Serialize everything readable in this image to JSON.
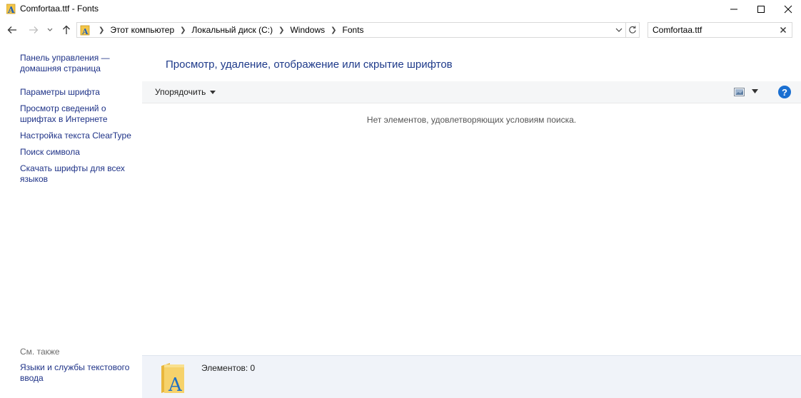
{
  "window": {
    "title": "Comfortaa.ttf - Fonts",
    "controls": [
      "minimize",
      "maximize",
      "close"
    ]
  },
  "nav": {
    "breadcrumbs": [
      "Этот компьютер",
      "Локальный диск (C:)",
      "Windows",
      "Fonts"
    ],
    "search_value": "Comfortaa.ttf"
  },
  "left_pane": {
    "links": [
      "Панель управления —\nдомашняя страница",
      "Параметры шрифта",
      "Просмотр сведений о\nшрифтах в Интернете",
      "Настройка текста ClearType",
      "Поиск символа",
      "Скачать шрифты для всех\nязыков"
    ],
    "see_also_label": "См. также",
    "see_also_links": [
      "Языки и службы текстового\nввода"
    ]
  },
  "main": {
    "title": "Просмотр, удаление, отображение или скрытие шрифтов",
    "organize_label": "Упорядочить",
    "help_label": "?",
    "empty_message": "Нет элементов, удовлетворяющих условиям поиска."
  },
  "details": {
    "items_count": "Элементов: 0"
  },
  "colors": {
    "link": "#1e3287",
    "title_blue": "#1e3a8a",
    "help_blue": "#1a6fd1",
    "details_bg": "#f0f3f9"
  }
}
